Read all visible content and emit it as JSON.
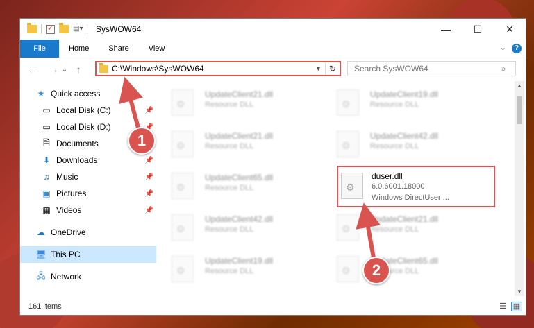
{
  "window": {
    "title": "SysWOW64",
    "controls": {
      "minimize": "—",
      "maximize": "☐",
      "close": "✕"
    }
  },
  "ribbon": {
    "tabs": [
      "File",
      "Home",
      "Share",
      "View"
    ],
    "help": "?"
  },
  "nav": {
    "back": "←",
    "forward": "→",
    "recent": "⌄",
    "up": "↑",
    "address": "C:\\Windows\\SysWOW64",
    "search_placeholder": "Search SysWOW64"
  },
  "sidebar": {
    "items": [
      {
        "label": "Quick access",
        "icon": "star-icon"
      },
      {
        "label": "Local Disk (C:)",
        "icon": "drive-icon"
      },
      {
        "label": "Local Disk (D:)",
        "icon": "drive-icon"
      },
      {
        "label": "Documents",
        "icon": "document-icon"
      },
      {
        "label": "Downloads",
        "icon": "download-icon"
      },
      {
        "label": "Music",
        "icon": "music-icon"
      },
      {
        "label": "Pictures",
        "icon": "picture-icon"
      },
      {
        "label": "Videos",
        "icon": "video-icon"
      },
      {
        "label": "OneDrive",
        "icon": "cloud-icon"
      },
      {
        "label": "This PC",
        "icon": "computer-icon"
      },
      {
        "label": "Network",
        "icon": "network-icon"
      }
    ]
  },
  "files": [
    {
      "name": "UpdateClient21.dll",
      "sub1": "Resource DLL",
      "sub2": ""
    },
    {
      "name": "UpdateClient19.dll",
      "sub1": "Resource DLL",
      "sub2": ""
    },
    {
      "name": "UpdateClient21.dll",
      "sub1": "Resource DLL",
      "sub2": ""
    },
    {
      "name": "UpdateClient42.dll",
      "sub1": "Resource DLL",
      "sub2": ""
    },
    {
      "name": "UpdateClient65.dll",
      "sub1": "Resource DLL",
      "sub2": ""
    },
    {
      "name": "duser.dll",
      "sub1": "6.0.6001.18000",
      "sub2": "Windows DirectUser ..."
    },
    {
      "name": "UpdateClient42.dll",
      "sub1": "Resource DLL",
      "sub2": ""
    },
    {
      "name": "UpdateClient21.dll",
      "sub1": "Resource DLL",
      "sub2": ""
    },
    {
      "name": "UpdateClient19.dll",
      "sub1": "Resource DLL",
      "sub2": ""
    },
    {
      "name": "UpdateClient65.dll",
      "sub1": "Resource DLL",
      "sub2": ""
    }
  ],
  "status": {
    "count": "161 items"
  },
  "callouts": [
    "1",
    "2"
  ],
  "colors": {
    "accent": "#1979ca",
    "highlight": "#d9534f",
    "selected": "#cce8ff"
  }
}
